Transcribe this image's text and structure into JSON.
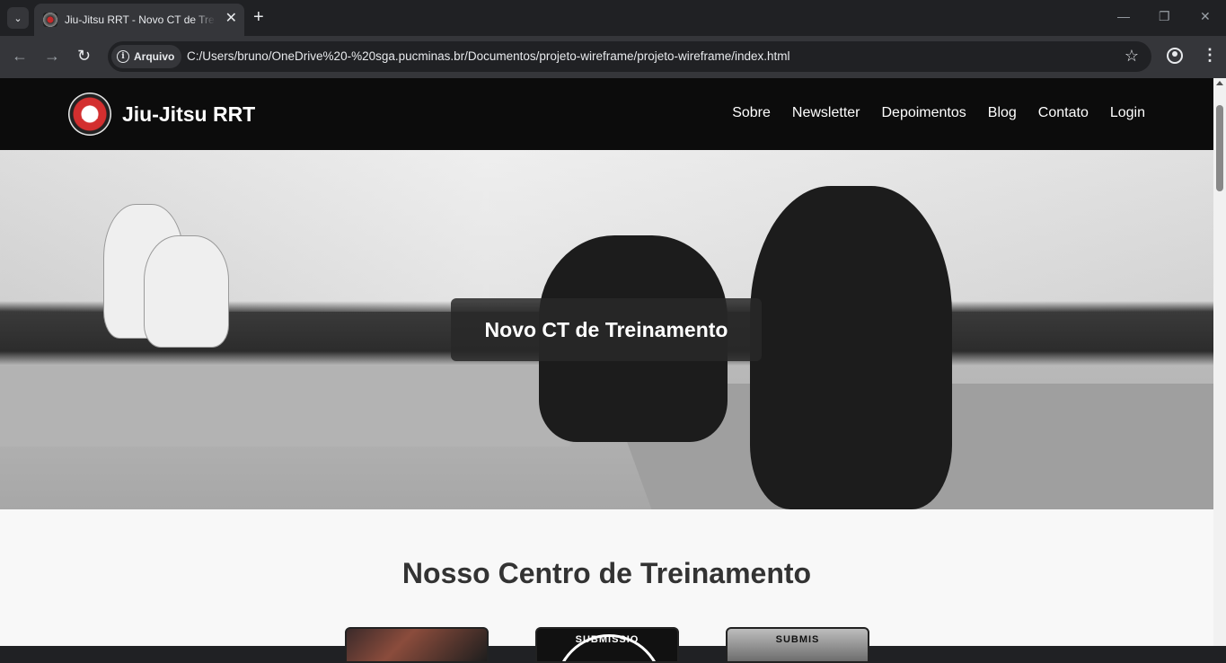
{
  "browser": {
    "tab_title": "Jiu-Jitsu RRT - Novo CT de Treinamento",
    "tab_close": "✕",
    "new_tab": "+",
    "tab_search": "⌄",
    "win_minimize": "—",
    "win_restore": "❐",
    "win_close": "✕",
    "back": "←",
    "forward": "→",
    "reload": "↻",
    "security_chip": "Arquivo",
    "url": "C:/Users/bruno/OneDrive%20-%20sga.pucminas.br/Documentos/projeto-wireframe/projeto-wireframe/index.html",
    "bookmark": "☆",
    "menu": "⋮"
  },
  "site": {
    "brand": "Jiu-Jitsu RRT",
    "nav": [
      "Sobre",
      "Newsletter",
      "Depoimentos",
      "Blog",
      "Contato",
      "Login"
    ],
    "hero_caption": "Novo CT de Treinamento",
    "section_title": "Nosso Centro de Treinamento",
    "cards": [
      {
        "text": ""
      },
      {
        "text": "SUBMISSIO"
      },
      {
        "text": "SUBMIS"
      }
    ]
  },
  "icons": {
    "info": "info-icon",
    "star": "star-icon",
    "profile": "profile-icon",
    "menu": "menu-icon",
    "logo": "jiu-jitsu-rrt-logo"
  },
  "colors": {
    "header_bg": "#0c0c0c",
    "page_bg": "#f8f8f8",
    "chrome_bg": "#202124",
    "toolbar_bg": "#35363a"
  }
}
